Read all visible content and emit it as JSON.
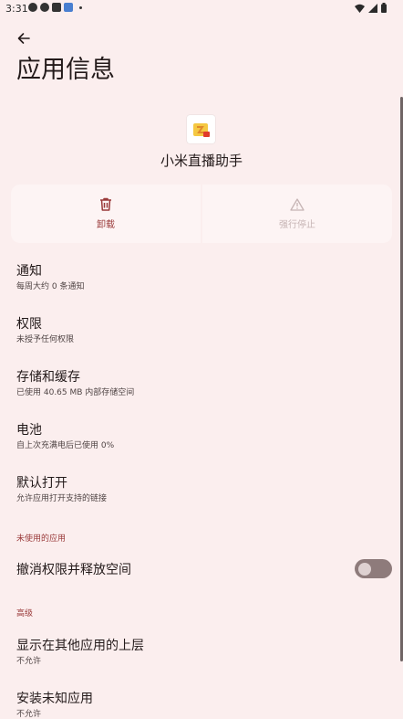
{
  "status_bar": {
    "time": "3:31"
  },
  "header": {
    "title": "应用信息"
  },
  "app": {
    "name": "小米直播助手"
  },
  "actions": {
    "uninstall_label": "卸载",
    "force_stop_label": "强行停止"
  },
  "settings": [
    {
      "title": "通知",
      "subtitle": "每周大约 0 条通知"
    },
    {
      "title": "权限",
      "subtitle": "未授予任何权限"
    },
    {
      "title": "存储和缓存",
      "subtitle": "已使用 40.65 MB 内部存储空间"
    },
    {
      "title": "电池",
      "subtitle": "自上次充满电后已使用 0%"
    },
    {
      "title": "默认打开",
      "subtitle": "允许应用打开支持的链接"
    }
  ],
  "unused_section": {
    "header": "未使用的应用",
    "toggle_label": "撤消权限并释放空间",
    "toggle_on": false
  },
  "advanced_section": {
    "header": "高级",
    "items": [
      {
        "title": "显示在其他应用的上层",
        "subtitle": "不允许"
      },
      {
        "title": "安装未知应用",
        "subtitle": "不允许"
      }
    ]
  },
  "colors": {
    "background": "#fbeeee",
    "accent": "#9a3a3a",
    "toggle_track": "#8e7b7b"
  }
}
